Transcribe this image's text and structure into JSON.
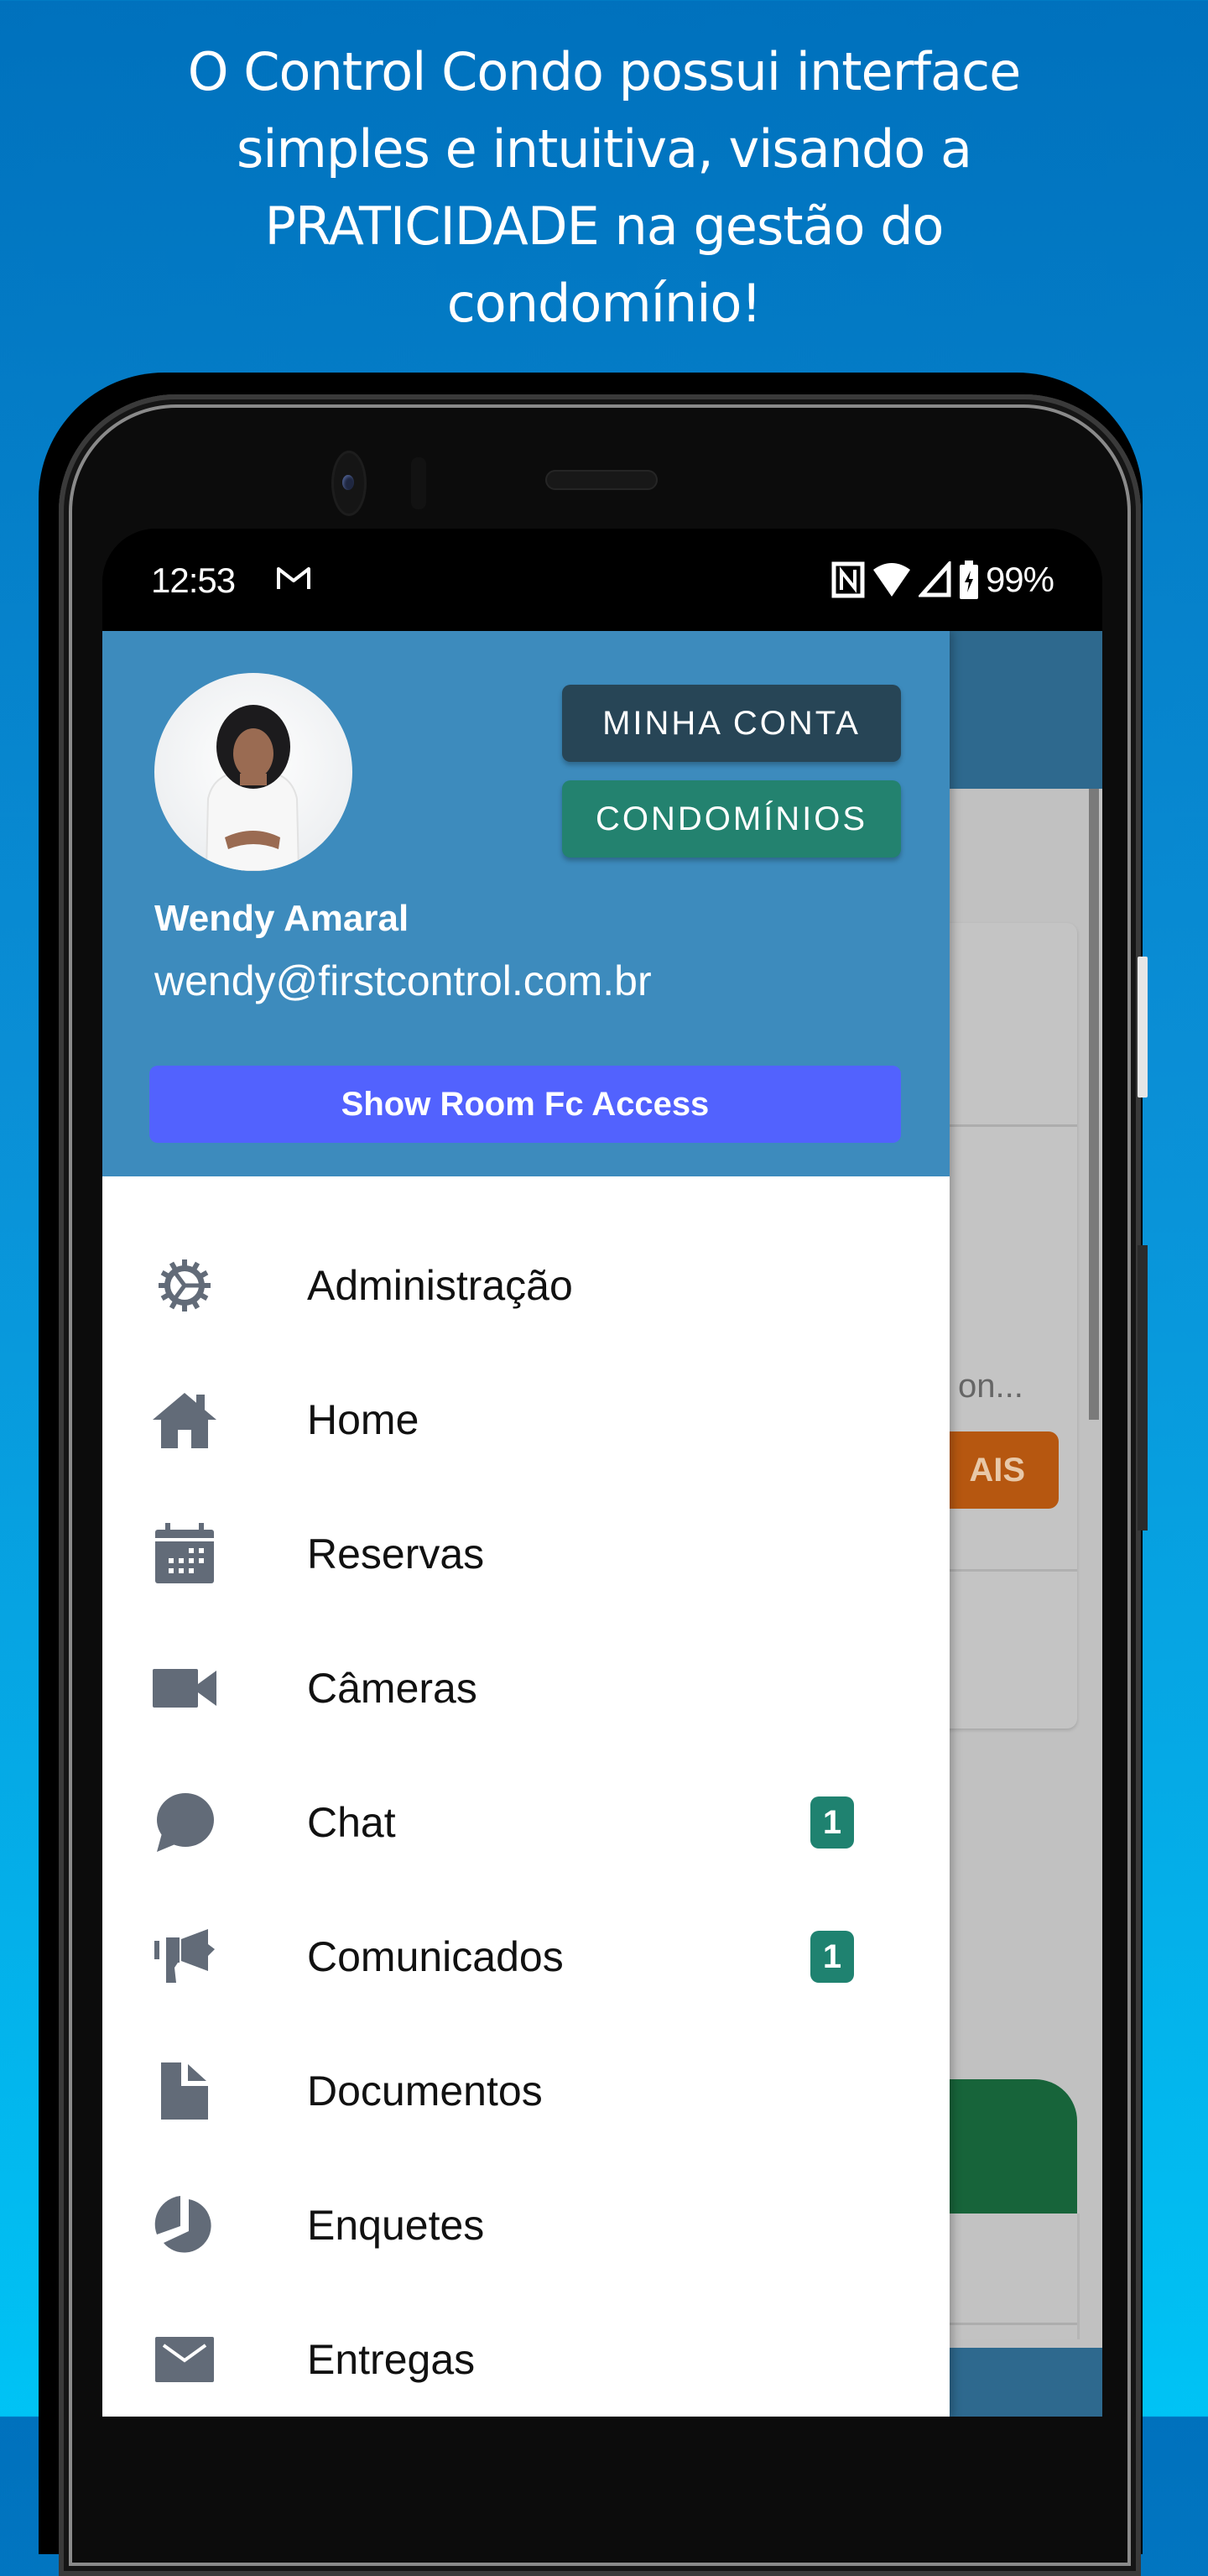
{
  "headline": {
    "lines": [
      "O Control Condo possui interface",
      "simples e intuitiva, visando a",
      "PRATICIDADE na gestão do",
      "condomínio!"
    ]
  },
  "statusbar": {
    "time": "12:53",
    "notification_icon": "gmail-icon",
    "icons": [
      "nfc-icon",
      "wifi-icon",
      "cell-signal-icon",
      "battery-charging-icon"
    ],
    "battery": "99%"
  },
  "drawer": {
    "header": {
      "account_button": "MINHA CONTA",
      "condos_button": "CONDOMÍNIOS",
      "user_name": "Wendy Amaral",
      "user_email": "wendy@firstcontrol.com.br",
      "showroom_button": "Show Room Fc Access"
    },
    "items": [
      {
        "label": "Administração",
        "icon": "gear-icon"
      },
      {
        "label": "Home",
        "icon": "home-icon"
      },
      {
        "label": "Reservas",
        "icon": "calendar-icon"
      },
      {
        "label": "Câmeras",
        "icon": "video-camera-icon"
      },
      {
        "label": "Chat",
        "icon": "chat-bubble-icon",
        "badge": "1"
      },
      {
        "label": "Comunicados",
        "icon": "megaphone-icon",
        "badge": "1"
      },
      {
        "label": "Documentos",
        "icon": "document-icon"
      },
      {
        "label": "Enquetes",
        "icon": "pie-chart-icon"
      },
      {
        "label": "Entregas",
        "icon": "envelope-icon"
      }
    ]
  },
  "background_app": {
    "card_text_fragment": "on...",
    "card_button_fragment": "AIS"
  },
  "colors": {
    "header_blue": "#3d8bbd",
    "account_button": "#274556",
    "condos_button": "#23826f",
    "showroom_button": "#5262fe",
    "badge_green": "#1f8270",
    "icon_gray": "#626b78"
  }
}
